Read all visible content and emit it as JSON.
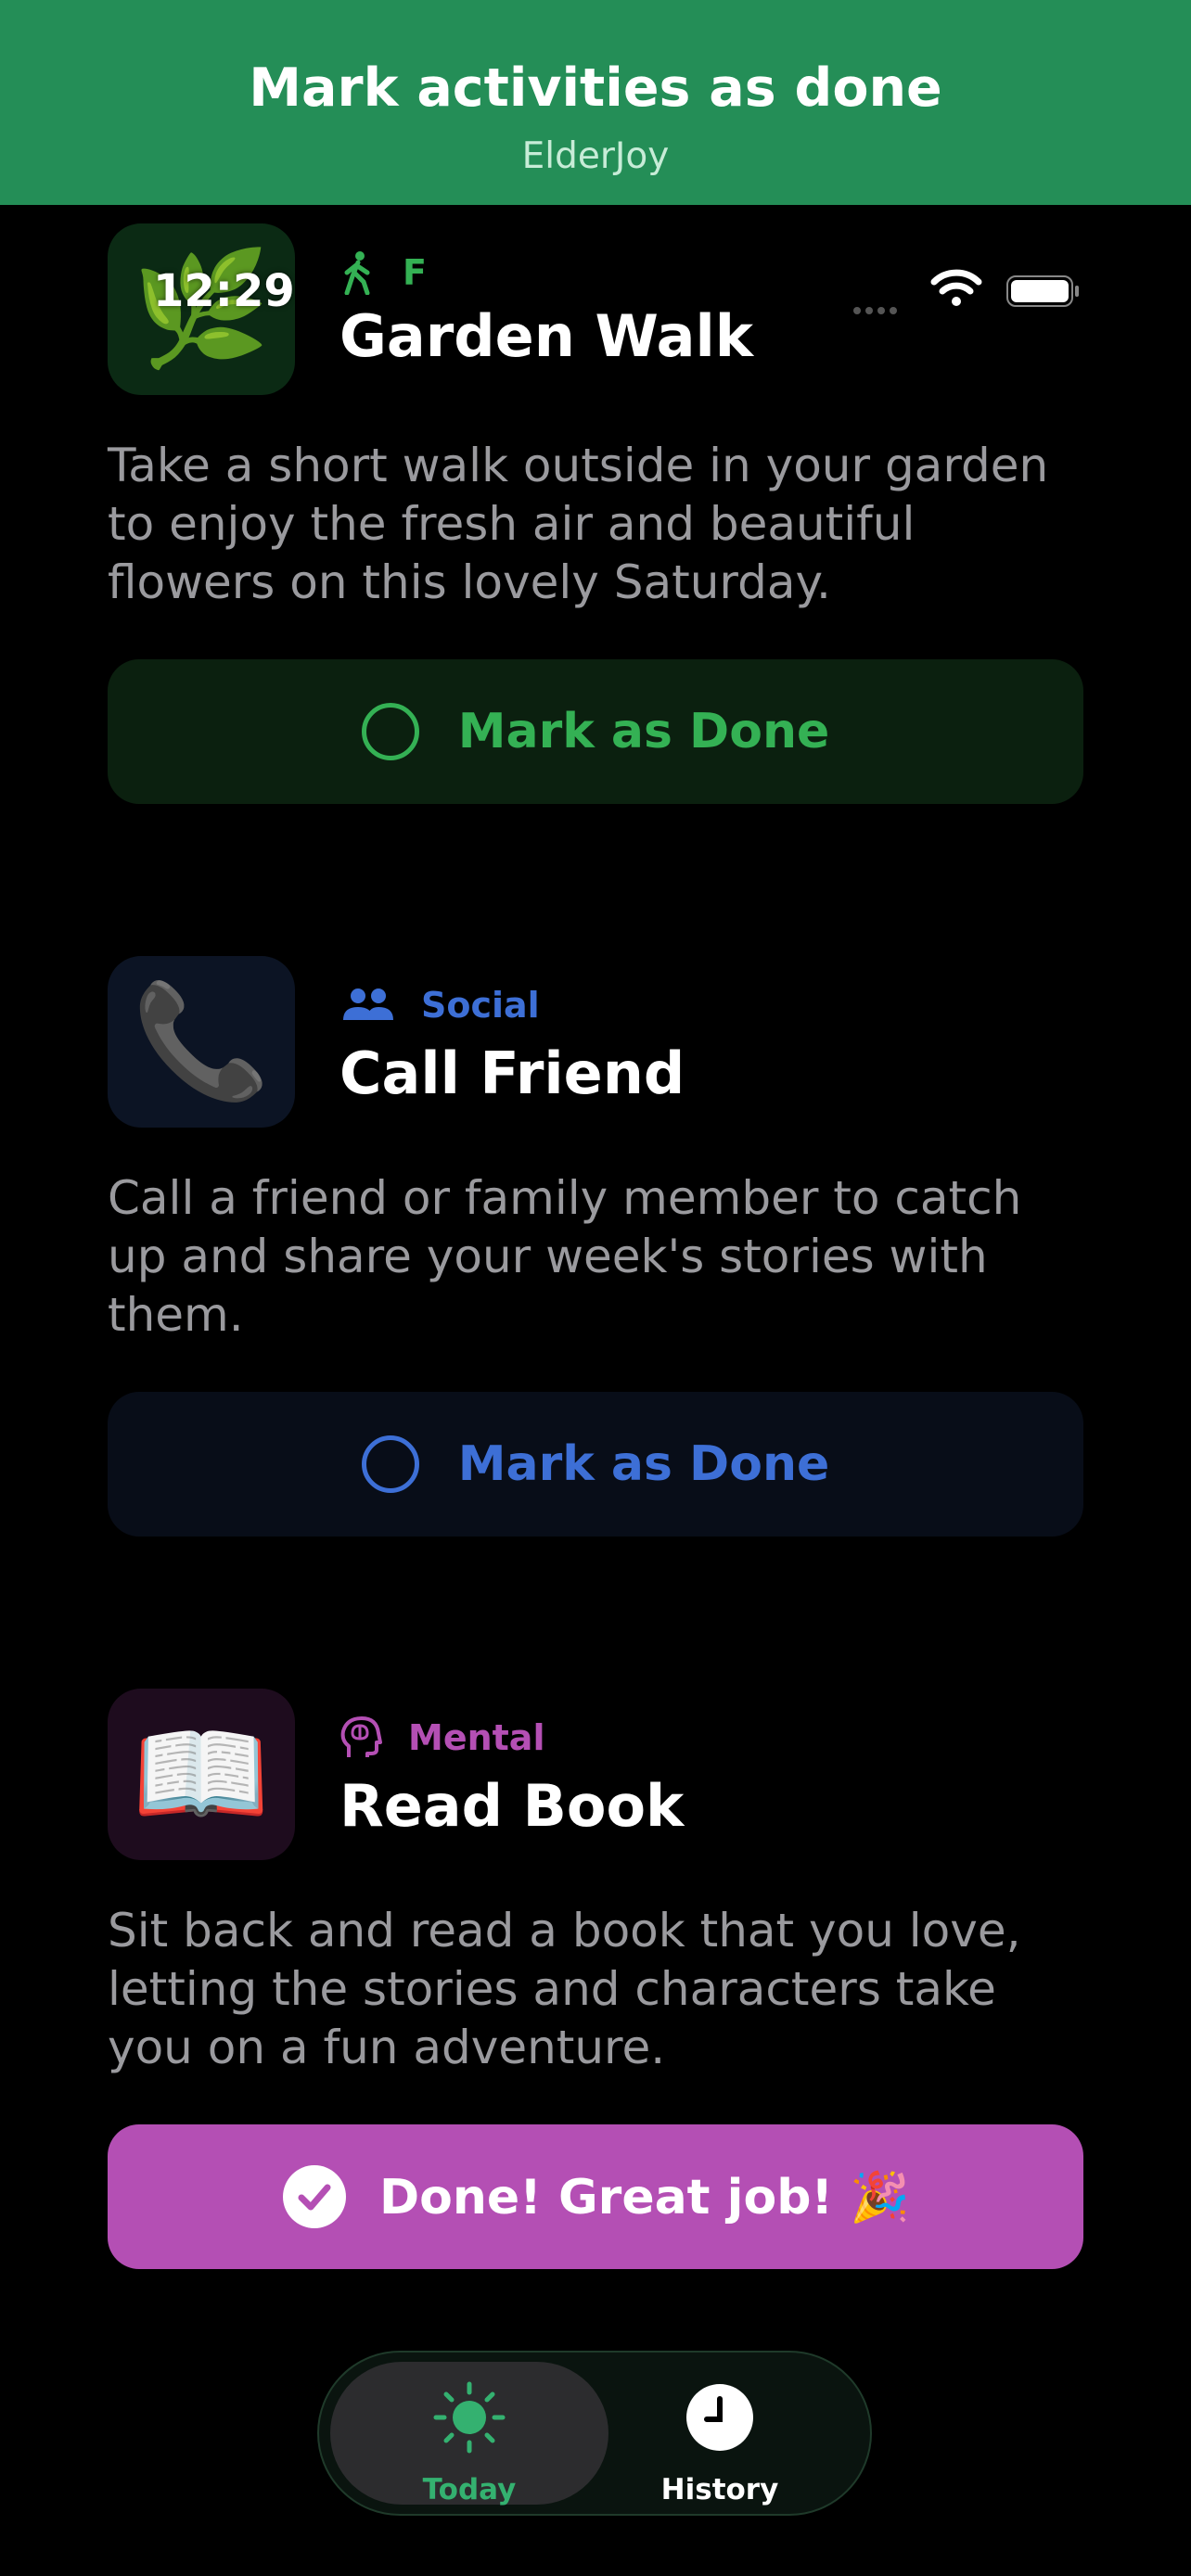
{
  "banner": {
    "title": "Mark activities as done",
    "subtitle": "ElderJoy"
  },
  "status_bar": {
    "time": "12:29"
  },
  "activities": [
    {
      "icon": "herb-emoji",
      "emoji": "🌿",
      "category": "F",
      "category_icon": "walking-icon",
      "title": "Garden Walk",
      "description": "Take a short walk outside in your garden to enjoy the fresh air and beautiful flowers on this lovely Saturday.",
      "button_label": "Mark as Done",
      "accent": "#34b154"
    },
    {
      "icon": "telephone-emoji",
      "emoji": "📞",
      "category": "Social",
      "category_icon": "people-icon",
      "title": "Call Friend",
      "description": "Call a friend or family member to catch up and share your week's stories with them.",
      "button_label": "Mark as Done",
      "accent": "#3d6fd6"
    },
    {
      "icon": "open-book-emoji",
      "emoji": "📖",
      "category": "Mental",
      "category_icon": "brain-head-icon",
      "title": "Read Book",
      "description": "Sit back and read a book that you love, letting the stories and characters take you on a fun adventure.",
      "button_label": "Done! Great job! 🎉",
      "accent": "#b44fb4"
    }
  ],
  "tab_bar": {
    "tabs": [
      {
        "label": "Today",
        "icon": "sun-icon",
        "active": true,
        "color": "#34b170"
      },
      {
        "label": "History",
        "icon": "clock-icon",
        "active": false,
        "color": "#ffffff"
      }
    ]
  }
}
